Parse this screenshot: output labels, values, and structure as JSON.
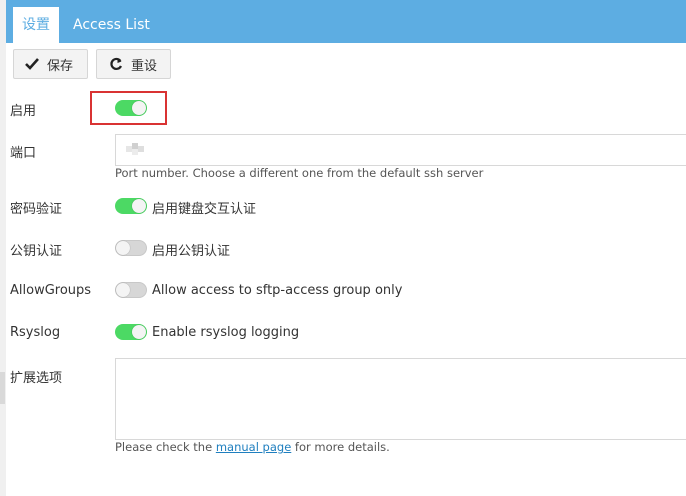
{
  "tabs": [
    {
      "label": "设置"
    },
    {
      "label": "Access List"
    }
  ],
  "toolbar": {
    "save_label": "保存",
    "reset_label": "重设"
  },
  "fields": {
    "enable": {
      "label": "启用",
      "on": true
    },
    "port": {
      "label": "端口",
      "value": "",
      "help": "Port number. Choose a different one from the default ssh server"
    },
    "password_auth": {
      "label": "密码验证",
      "on": true,
      "text": "启用键盘交互认证"
    },
    "pubkey_auth": {
      "label": "公钥认证",
      "on": false,
      "text": "启用公钥认证"
    },
    "allow_groups": {
      "label": "AllowGroups",
      "on": false,
      "text": "Allow access to sftp-access group only"
    },
    "rsyslog": {
      "label": "Rsyslog",
      "on": true,
      "text": "Enable rsyslog logging"
    },
    "extra_options": {
      "label": "扩展选项",
      "value": "",
      "help_prefix": "Please check the ",
      "help_link": "manual page",
      "help_suffix": " for more details."
    }
  },
  "colors": {
    "tabbar": "#5dade2",
    "toggle_on": "#4cd964",
    "toggle_off": "#d7d7d7",
    "highlight": "#d93333",
    "link": "#1f7fbf"
  }
}
